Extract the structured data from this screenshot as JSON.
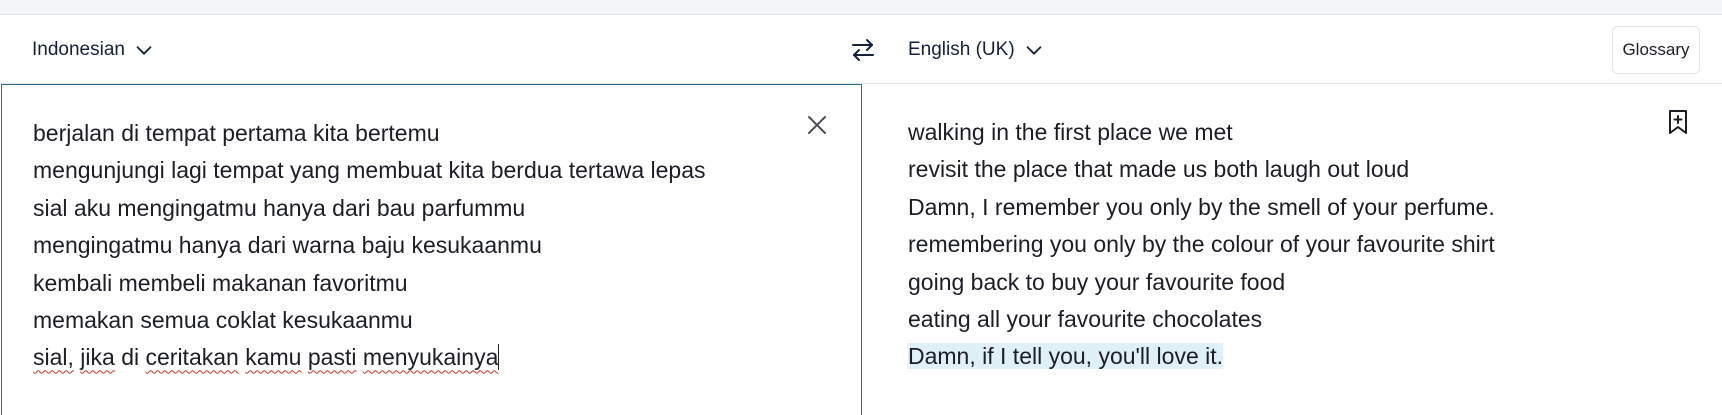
{
  "header": {
    "source_language": "Indonesian",
    "target_language": "English (UK)",
    "glossary_label": "Glossary",
    "icons": {
      "source_dropdown": "chevron-down-icon",
      "target_dropdown": "chevron-down-icon",
      "swap": "swap-arrows-icon"
    }
  },
  "source": {
    "lines": [
      "berjalan di tempat pertama kita bertemu",
      "mengunjungi lagi tempat yang membuat kita berdua tertawa lepas",
      "sial aku mengingatmu hanya dari bau parfummu",
      "mengingatmu hanya dari warna baju kesukaanmu",
      "kembali membeli makanan favoritmu",
      "memakan semua coklat kesukaanmu"
    ],
    "last_line_words": [
      "sial,",
      "jika",
      "di",
      "ceritakan",
      "kamu",
      "pasti",
      "menyukainya"
    ],
    "icons": {
      "clear": "close-icon"
    }
  },
  "target": {
    "lines": [
      "walking in the first place we met",
      "revisit the place that made us both laugh out loud",
      "Damn, I remember you only by the smell of your perfume.",
      "remembering you only by the colour of your favourite shirt",
      "going back to buy your favourite food",
      "eating all your favourite chocolates"
    ],
    "highlighted_line": "Damn, if I tell you, you'll love it.",
    "icons": {
      "save": "bookmark-add-icon"
    }
  },
  "colors": {
    "active_border": "#2c6b8f",
    "highlight": "#dff0f6",
    "spellcheck": "#d93025",
    "header_text": "#14213d"
  }
}
